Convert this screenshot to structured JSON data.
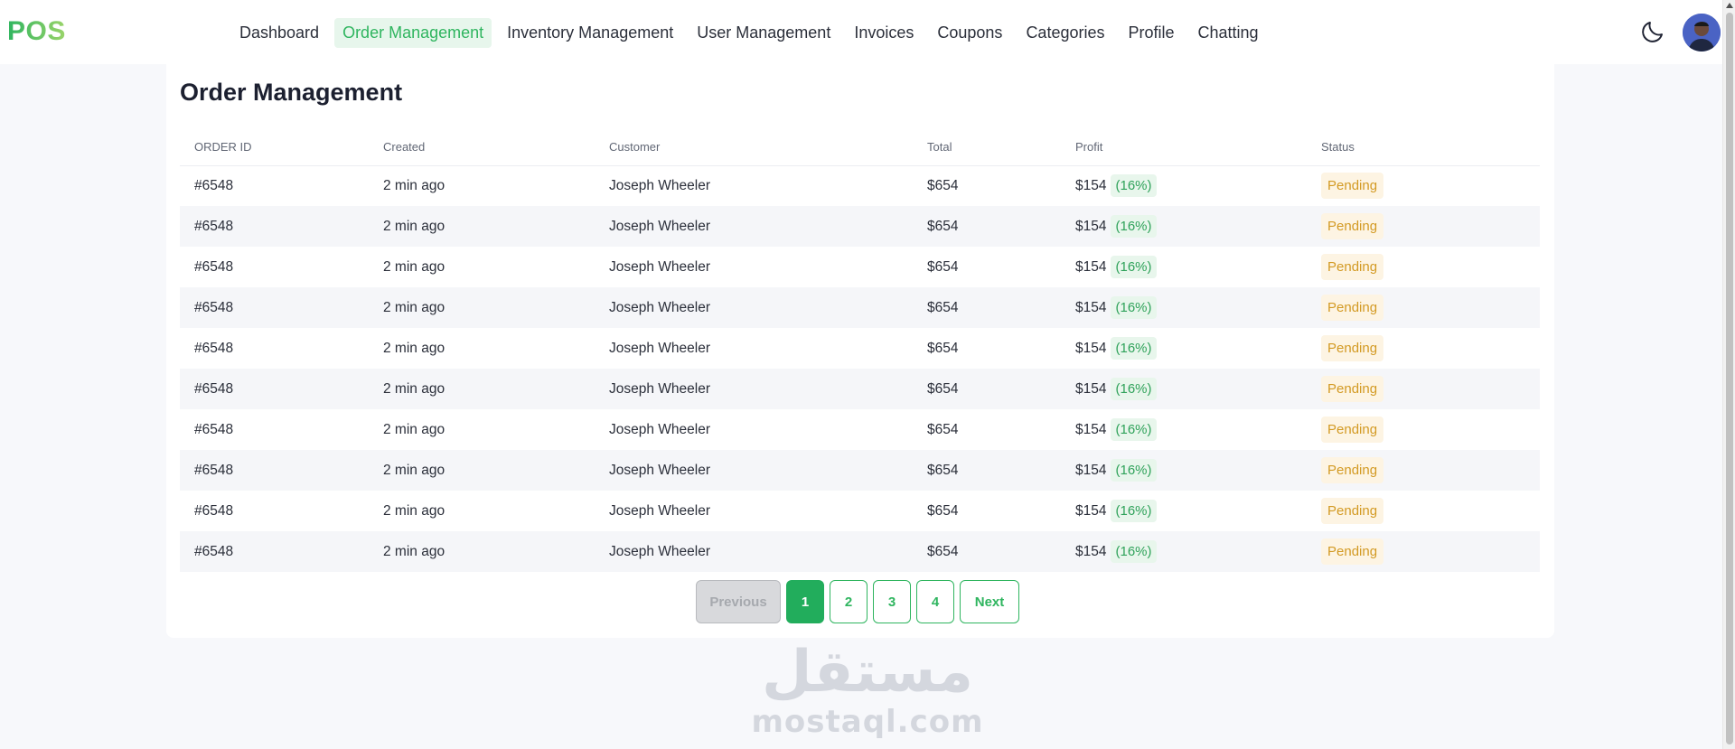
{
  "app": {
    "logo": "POS"
  },
  "nav": {
    "items": [
      {
        "label": "Dashboard",
        "active": false
      },
      {
        "label": "Order Management",
        "active": true
      },
      {
        "label": "Inventory Management",
        "active": false
      },
      {
        "label": "User Management",
        "active": false
      },
      {
        "label": "Invoices",
        "active": false
      },
      {
        "label": "Coupons",
        "active": false
      },
      {
        "label": "Categories",
        "active": false
      },
      {
        "label": "Profile",
        "active": false
      },
      {
        "label": "Chatting",
        "active": false
      }
    ]
  },
  "header_icons": {
    "theme_toggle": "moon-icon",
    "avatar": "user-avatar"
  },
  "page": {
    "title": "Order Management"
  },
  "table": {
    "columns": [
      "ORDER ID",
      "Created",
      "Customer",
      "Total",
      "Profit",
      "Status"
    ],
    "rows": [
      {
        "order_id": "#6548",
        "created": "2 min ago",
        "customer": "Joseph Wheeler",
        "total": "$654",
        "profit": "$154",
        "profit_pct": "(16%)",
        "status": "Pending"
      },
      {
        "order_id": "#6548",
        "created": "2 min ago",
        "customer": "Joseph Wheeler",
        "total": "$654",
        "profit": "$154",
        "profit_pct": "(16%)",
        "status": "Pending"
      },
      {
        "order_id": "#6548",
        "created": "2 min ago",
        "customer": "Joseph Wheeler",
        "total": "$654",
        "profit": "$154",
        "profit_pct": "(16%)",
        "status": "Pending"
      },
      {
        "order_id": "#6548",
        "created": "2 min ago",
        "customer": "Joseph Wheeler",
        "total": "$654",
        "profit": "$154",
        "profit_pct": "(16%)",
        "status": "Pending"
      },
      {
        "order_id": "#6548",
        "created": "2 min ago",
        "customer": "Joseph Wheeler",
        "total": "$654",
        "profit": "$154",
        "profit_pct": "(16%)",
        "status": "Pending"
      },
      {
        "order_id": "#6548",
        "created": "2 min ago",
        "customer": "Joseph Wheeler",
        "total": "$654",
        "profit": "$154",
        "profit_pct": "(16%)",
        "status": "Pending"
      },
      {
        "order_id": "#6548",
        "created": "2 min ago",
        "customer": "Joseph Wheeler",
        "total": "$654",
        "profit": "$154",
        "profit_pct": "(16%)",
        "status": "Pending"
      },
      {
        "order_id": "#6548",
        "created": "2 min ago",
        "customer": "Joseph Wheeler",
        "total": "$654",
        "profit": "$154",
        "profit_pct": "(16%)",
        "status": "Pending"
      },
      {
        "order_id": "#6548",
        "created": "2 min ago",
        "customer": "Joseph Wheeler",
        "total": "$654",
        "profit": "$154",
        "profit_pct": "(16%)",
        "status": "Pending"
      },
      {
        "order_id": "#6548",
        "created": "2 min ago",
        "customer": "Joseph Wheeler",
        "total": "$654",
        "profit": "$154",
        "profit_pct": "(16%)",
        "status": "Pending"
      }
    ]
  },
  "pagination": {
    "previous_label": "Previous",
    "next_label": "Next",
    "pages": [
      "1",
      "2",
      "3",
      "4"
    ],
    "current_page": "1"
  },
  "watermark": {
    "arabic": "مستقل",
    "latin": "mostaql.com"
  },
  "colors": {
    "accent": "#2fb55f",
    "pending": "#d39a23",
    "background": "#f7f8fb"
  }
}
